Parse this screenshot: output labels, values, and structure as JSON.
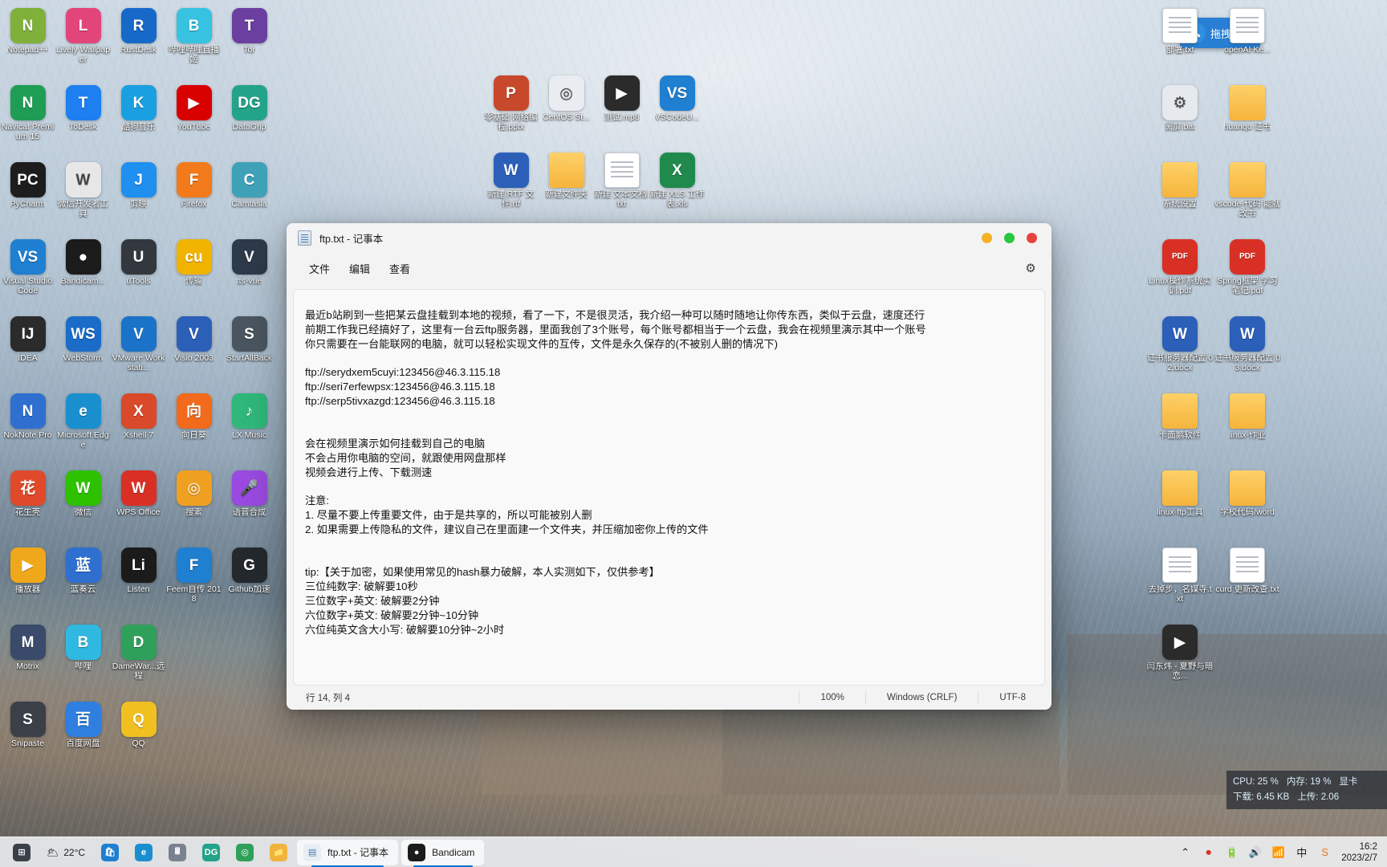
{
  "desktop": {
    "drag_upload": {
      "label": "拖拽上传",
      "icon": "cloud-upload-icon"
    },
    "left_icons": [
      {
        "label": "Notepad++",
        "icon": "notepadpp-icon",
        "color": "#7fb03a",
        "ch": "N"
      },
      {
        "label": "Lively Wallpaper",
        "icon": "lively-wallpaper-icon",
        "color": "#e2457a",
        "ch": "L"
      },
      {
        "label": "RustDesk",
        "icon": "rustdesk-icon",
        "color": "#1769c8",
        "ch": "R"
      },
      {
        "label": "哔哩哔哩直播姬",
        "icon": "bilibili-live-icon",
        "color": "#36c2e0",
        "ch": "B"
      },
      {
        "label": "Tor",
        "icon": "tor-icon",
        "color": "#6b3fa0",
        "ch": "T"
      },
      {
        "label": "Navicat Premium 15",
        "icon": "navicat-icon",
        "color": "#1f9d55",
        "ch": "N"
      },
      {
        "label": "ToDesk",
        "icon": "todesk-icon",
        "color": "#1d7ff0",
        "ch": "T"
      },
      {
        "label": "酷狗音乐",
        "icon": "kugou-icon",
        "color": "#1aa0e0",
        "ch": "K"
      },
      {
        "label": "YouTube",
        "icon": "youtube-icon",
        "color": "#d90000",
        "ch": "▶"
      },
      {
        "label": "DataGrip",
        "icon": "datagrip-icon",
        "color": "#23a38a",
        "ch": "DG"
      },
      {
        "label": "PyCharm",
        "icon": "pycharm-icon",
        "color": "#1d1d1d",
        "ch": "PC"
      },
      {
        "label": "微信开发者工具",
        "icon": "wechat-devtools-icon",
        "color": "#e7e7e7",
        "ch": "W"
      },
      {
        "label": "剪映",
        "icon": "jianying-icon",
        "color": "#1f8ff0",
        "ch": "J"
      },
      {
        "label": "Firefox",
        "icon": "firefox-icon",
        "color": "#f27a1a",
        "ch": "F"
      },
      {
        "label": "Camtasia",
        "icon": "camtasia-icon",
        "color": "#3fa1b8",
        "ch": "C"
      },
      {
        "label": "Visual Studio Code",
        "icon": "vscode-icon",
        "color": "#1f7fd0",
        "ch": "VS"
      },
      {
        "label": "Bandicam...",
        "icon": "bandicam-icon",
        "color": "#1b1b1b",
        "ch": "●"
      },
      {
        "label": "uTools",
        "icon": "utools-icon",
        "color": "#33383f",
        "ch": "U"
      },
      {
        "label": "传输",
        "icon": "cute-me-icon",
        "color": "#f0b400",
        "ch": "cu"
      },
      {
        "label": "tts-vue",
        "icon": "tts-vue-icon",
        "color": "#2d3a4a",
        "ch": "V"
      },
      {
        "label": "IDEA",
        "icon": "intellij-idea-icon",
        "color": "#2b2b2b",
        "ch": "IJ"
      },
      {
        "label": "WebStorm",
        "icon": "webstorm-icon",
        "color": "#1a6cc8",
        "ch": "WS"
      },
      {
        "label": "VMware Workstati...",
        "icon": "vmware-icon",
        "color": "#1a73c8",
        "ch": "V"
      },
      {
        "label": "Visio 2003",
        "icon": "visio-icon",
        "color": "#2b5fb8",
        "ch": "V"
      },
      {
        "label": "StartAllBack",
        "icon": "startallback-icon",
        "color": "#4a5560",
        "ch": "S"
      },
      {
        "label": "NokNote Pro",
        "icon": "noknote-icon",
        "color": "#2f6fd0",
        "ch": "N"
      },
      {
        "label": "Microsoft Edge",
        "icon": "edge-icon",
        "color": "#1a8fd0",
        "ch": "e"
      },
      {
        "label": "Xshell 7",
        "icon": "xshell-icon",
        "color": "#d94a2a",
        "ch": "X"
      },
      {
        "label": "向日葵",
        "icon": "sunflower-icon",
        "color": "#f26a1b",
        "ch": "向"
      },
      {
        "label": "LX Music",
        "icon": "lx-music-icon",
        "color": "#2fb87a",
        "ch": "♪"
      },
      {
        "label": "花生壳",
        "icon": "oray-icon",
        "color": "#e04a2a",
        "ch": "花"
      },
      {
        "label": "微信",
        "icon": "wechat-icon",
        "color": "#2dc100",
        "ch": "W"
      },
      {
        "label": "WPS Office",
        "icon": "wps-office-icon",
        "color": "#d93025",
        "ch": "W"
      },
      {
        "label": "搜索",
        "icon": "search-app-icon",
        "color": "#f0a020",
        "ch": "◎"
      },
      {
        "label": "语音合成",
        "icon": "tts-app-icon",
        "color": "#9a4ae0",
        "ch": "🎤"
      },
      {
        "label": "播放器",
        "icon": "potplayer-icon",
        "color": "#f0a81b",
        "ch": "▶"
      },
      {
        "label": "蓝奏云",
        "icon": "lanzou-icon",
        "color": "#2f6fd0",
        "ch": "蓝"
      },
      {
        "label": "Listen",
        "icon": "listen-icon",
        "color": "#1b1b1b",
        "ch": "Li"
      },
      {
        "label": "Feem自传 2018",
        "icon": "feem-icon",
        "color": "#1f7fd0",
        "ch": "F"
      },
      {
        "label": "Github加速",
        "icon": "github-icon",
        "color": "#24292e",
        "ch": "G"
      },
      {
        "label": "Motrix",
        "icon": "motrix-icon",
        "color": "#3a4a6a",
        "ch": "M"
      },
      {
        "label": "哔哩",
        "icon": "bilibili-icon",
        "color": "#2fb8e0",
        "ch": "B"
      },
      {
        "label": "DameWar...远程",
        "icon": "damewar-icon",
        "color": "#2fa05a",
        "ch": "D"
      },
      {
        "label": "",
        "icon": "empty-icon",
        "color": "transparent",
        "ch": ""
      },
      {
        "label": "",
        "icon": "empty-icon",
        "color": "transparent",
        "ch": ""
      },
      {
        "label": "Snipaste",
        "icon": "snipaste-icon",
        "color": "#3a3f48",
        "ch": "S"
      },
      {
        "label": "百度网盘",
        "icon": "baidu-netdisk-icon",
        "color": "#2f7fe0",
        "ch": "百"
      },
      {
        "label": "QQ",
        "icon": "qq-icon",
        "color": "#f0c020",
        "ch": "Q"
      }
    ],
    "mid_icons": [
      {
        "label": "零基础 网络编程.pptx",
        "icon": "powerpoint-file-icon",
        "color": "#c8482b",
        "ch": "P"
      },
      {
        "label": "CentOS St...",
        "icon": "iso-file-icon",
        "color": "#e9ecf0",
        "ch": "◎"
      },
      {
        "label": "测试.mp8",
        "icon": "video-file-icon",
        "color": "#2b2b2b",
        "ch": "▶"
      },
      {
        "label": "VSCodeU...",
        "icon": "vscode-file-icon",
        "color": "#1f7fd0",
        "ch": "VS"
      },
      {
        "label": "新建 RTF 文件.rtf",
        "icon": "word-file-icon",
        "color": "#2b5fb8",
        "ch": "W"
      },
      {
        "label": "新建文件夹",
        "icon": "folder-icon",
        "color": "#f5b43c",
        "ch": ""
      },
      {
        "label": "新建 文本文档.txt",
        "icon": "text-file-icon",
        "color": "#ffffff",
        "ch": ""
      },
      {
        "label": "新建 XLS 工作表.xls",
        "icon": "excel-file-icon",
        "color": "#1f8a4c",
        "ch": "X"
      }
    ],
    "right_icons": [
      {
        "label": "部署.txt",
        "icon": "text-file-icon",
        "color": "#ffffff",
        "ch": ""
      },
      {
        "label": "openAI Ke...",
        "icon": "text-file-icon",
        "color": "#ffffff",
        "ch": ""
      },
      {
        "label": "黑屏.bat",
        "icon": "bat-file-icon",
        "color": "#e6e9ed",
        "ch": "⚙"
      },
      {
        "label": "huanqu 证书",
        "icon": "folder-icon",
        "color": "#f5b43c",
        "ch": ""
      },
      {
        "label": "系统设置",
        "icon": "folder-icon",
        "color": "#f5b43c",
        "ch": ""
      },
      {
        "label": "vscode-代码 能就改书",
        "icon": "folder-icon",
        "color": "#f5b43c",
        "ch": ""
      },
      {
        "label": "Linux操作系统实训.pdf",
        "icon": "pdf-file-icon",
        "color": "#d93025",
        "ch": "PDF"
      },
      {
        "label": "Spring框架 学习笔记.pdf",
        "icon": "pdf-file-icon",
        "color": "#d93025",
        "ch": "PDF"
      },
      {
        "label": "证书服务器配置 02.docx",
        "icon": "word-file-icon",
        "color": "#2b5fb8",
        "ch": "W"
      },
      {
        "label": "证书服务器配置 03.docx",
        "icon": "word-file-icon",
        "color": "#2b5fb8",
        "ch": "W"
      },
      {
        "label": "卡面鹅软件",
        "icon": "folder-icon",
        "color": "#f5b43c",
        "ch": ""
      },
      {
        "label": "linux-作业",
        "icon": "folder-icon",
        "color": "#f5b43c",
        "ch": ""
      },
      {
        "label": "linux-ftp工具",
        "icon": "folder-icon",
        "color": "#f5b43c",
        "ch": ""
      },
      {
        "label": "学校代码/word",
        "icon": "folder-icon",
        "color": "#f5b43c",
        "ch": ""
      },
      {
        "label": "去掉步，名媒寺.txt",
        "icon": "text-file-icon",
        "color": "#ffffff",
        "ch": ""
      },
      {
        "label": "curd 更新改查.txt",
        "icon": "text-file-icon",
        "color": "#ffffff",
        "ch": ""
      },
      {
        "label": "闫东炜 - 夏野与暗恋...",
        "icon": "video-file-icon",
        "color": "#2b2b2b",
        "ch": "▶"
      }
    ]
  },
  "notepad": {
    "title": "ftp.txt - 记事本",
    "window_icon": "notepad-icon",
    "buttons": {
      "minimize_color": "#f5b225",
      "maximize_color": "#28c840",
      "close_color": "#e8433b"
    },
    "menus": [
      "文件",
      "编辑",
      "查看"
    ],
    "settings_icon": "gear-icon",
    "content": "最近b站刷到一些把某云盘挂载到本地的视频，看了一下，不是很灵活，我介绍一种可以随时随地让你传东西，类似于云盘，速度还行\n前期工作我已经搞好了，这里有一台云ftp服务器，里面我创了3个账号，每个账号都相当于一个云盘，我会在视频里演示其中一个账号\n你只需要在一台能联网的电脑，就可以轻松实现文件的互传，文件是永久保存的(不被别人删的情况下)\n\nftp://serydxem5cuyi:123456@46.3.115.18\nftp://seri7erfewpsx:123456@46.3.115.18\nftp://serp5tivxazgd:123456@46.3.115.18\n\n\n会在视频里演示如何挂载到自己的电脑\n不会占用你电脑的空间，就跟使用网盘那样\n视频会进行上传、下载测速\n\n注意:\n1. 尽量不要上传重要文件，由于是共享的，所以可能被别人删\n2. 如果需要上传隐私的文件，建议自己在里面建一个文件夹，并压缩加密你上传的文件\n\n\ntip:【关于加密，如果使用常见的hash暴力破解，本人实测如下，仅供参考】\n三位纯数字: 破解要10秒\n三位数字+英文: 破解要2分钟\n六位数字+英文: 破解要2分钟~10分钟\n六位纯英文含大小写: 破解要10分钟~2小时",
    "statusbar": {
      "position": "行 14, 列 4",
      "zoom": "100%",
      "line_ending": "Windows (CRLF)",
      "encoding": "UTF-8"
    }
  },
  "perf_hud": {
    "cpu_label": "CPU: 25 %",
    "mem_label": "内存: 19 %",
    "gpu_label": "显卡",
    "download_label": "下载: 6.45 KB",
    "upload_label": "上传: 2.06"
  },
  "taskbar": {
    "weather": {
      "temp": "22°C",
      "icon": "weather-cloud-icon"
    },
    "apps": [
      {
        "label": "",
        "icon": "start-icon",
        "color": "#3a3f48",
        "ch": "⊞"
      },
      {
        "label": "",
        "icon": "microsoft-store-icon",
        "color": "#1f7fd0",
        "ch": "🛍"
      },
      {
        "label": "",
        "icon": "edge-icon",
        "color": "#1a8fd0",
        "ch": "e"
      },
      {
        "label": "",
        "icon": "calculator-icon",
        "color": "#7a8290",
        "ch": "🖩"
      },
      {
        "label": "",
        "icon": "datagrip-icon",
        "color": "#23a38a",
        "ch": "DG"
      },
      {
        "label": "",
        "icon": "chrome-icon",
        "color": "#2fa05a",
        "ch": "◎"
      },
      {
        "label": "",
        "icon": "file-explorer-icon",
        "color": "#f0b43c",
        "ch": "📁"
      }
    ],
    "labeled_apps": [
      {
        "label": "ftp.txt - 记事本",
        "icon": "notepad-icon",
        "color": "#e9eef4",
        "ch": ""
      },
      {
        "label": "Bandicam",
        "icon": "bandicam-icon",
        "color": "#1b1b1b",
        "ch": "●"
      }
    ],
    "tray_icons": [
      "chevron-up-icon",
      "record-icon",
      "battery-icon",
      "volume-icon",
      "wifi-icon",
      "ime-chinese-icon",
      "sogou-icon"
    ],
    "clock": {
      "time": "16:2",
      "date": "2023/2/7"
    }
  }
}
